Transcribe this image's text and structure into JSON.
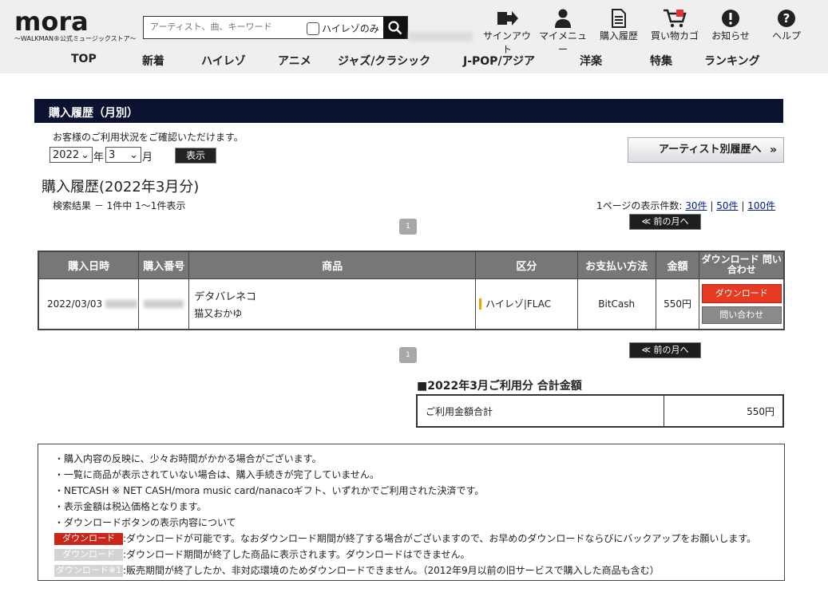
{
  "logo": {
    "main": "mora",
    "sub": "〜WALKMAN®公式ミュージックストア〜"
  },
  "search": {
    "placeholder": "アーティスト、曲、キーワード",
    "hires_only": "ハイレゾのみ"
  },
  "top_nav": [
    {
      "label": "サインアウト",
      "icon": "signout-icon"
    },
    {
      "label": "マイメニュー",
      "icon": "user-icon"
    },
    {
      "label": "購入履歴",
      "icon": "document-icon"
    },
    {
      "label": "買い物カゴ",
      "icon": "cart-icon"
    },
    {
      "label": "お知らせ",
      "icon": "alert-icon"
    },
    {
      "label": "ヘルプ",
      "icon": "help-icon"
    }
  ],
  "global_nav": [
    "TOP",
    "新着",
    "ハイレゾ",
    "アニメ",
    "ジャズ/クラシック",
    "J-POP/アジア",
    "洋楽",
    "特集",
    "ランキング"
  ],
  "section_bar": "購入履歴（月別）",
  "intro": "お客様のご利用状況をご確認いただけます。",
  "filter": {
    "year": "2022",
    "year_label": "年",
    "month": "3",
    "month_label": "月",
    "show_button": "表示"
  },
  "artist_history_button": "アーティスト別履歴へ",
  "page_title": "購入履歴(2022年3月分)",
  "result_text": "検索結果 － 1件中 1〜1件表示",
  "per_page": {
    "label": "1ページの表示件数:",
    "options": [
      "30件",
      "50件",
      "100件"
    ]
  },
  "pagination": {
    "page": "1",
    "prev_month": "≪ 前の月へ"
  },
  "table": {
    "headers": [
      "購入日時",
      "購入番号",
      "商品",
      "区分",
      "お支払い方法",
      "金額",
      "ダウンロード 問い合わせ"
    ],
    "rows": [
      {
        "date": "2022/03/03",
        "title": "デタバレネコ",
        "artist": "猫又おかゆ",
        "category": "ハイレゾ|FLAC",
        "payment": "BitCash",
        "price": "550円",
        "download": "ダウンロード",
        "inquiry": "問い合わせ"
      }
    ]
  },
  "total": {
    "title": "■2022年3月ご利用分 合計金額",
    "label": "ご利用金額合計",
    "amount": "550円"
  },
  "notes": [
    "・購入内容の反映に、少々お時間がかかる場合がございます。",
    "・一覧に商品が表示されていない場合は、購入手続きが完了していません。",
    "・NETCASH ※ NET CASH/mora music card/nanacoギフト、いずれかでご利用された決済です。",
    "・表示金額は税込価格となります。",
    "・ダウンロードボタンの表示内容について"
  ],
  "legend": [
    {
      "tag": "ダウンロード",
      "text": ":ダウンロードが可能です。なおダウンロード期間が終了する場合がございますので、お早めのダウンロードならびにバックアップをお願いします。"
    },
    {
      "tag": "ダウンロード",
      "text": ":ダウンロード期間が終了した商品に表示されます。ダウンロードはできません。"
    },
    {
      "tag": "ダウンロード※1",
      "text": ":販売期間が終了したか、非対応環境のためダウンロードできません。（2012年9月以前の旧サービスで購入した商品も含む）"
    }
  ],
  "colors": {
    "header_bg": "#efefef",
    "bar_bg": "#0c1330",
    "download_red": "#e73a22",
    "link_blue": "#001d8c"
  }
}
